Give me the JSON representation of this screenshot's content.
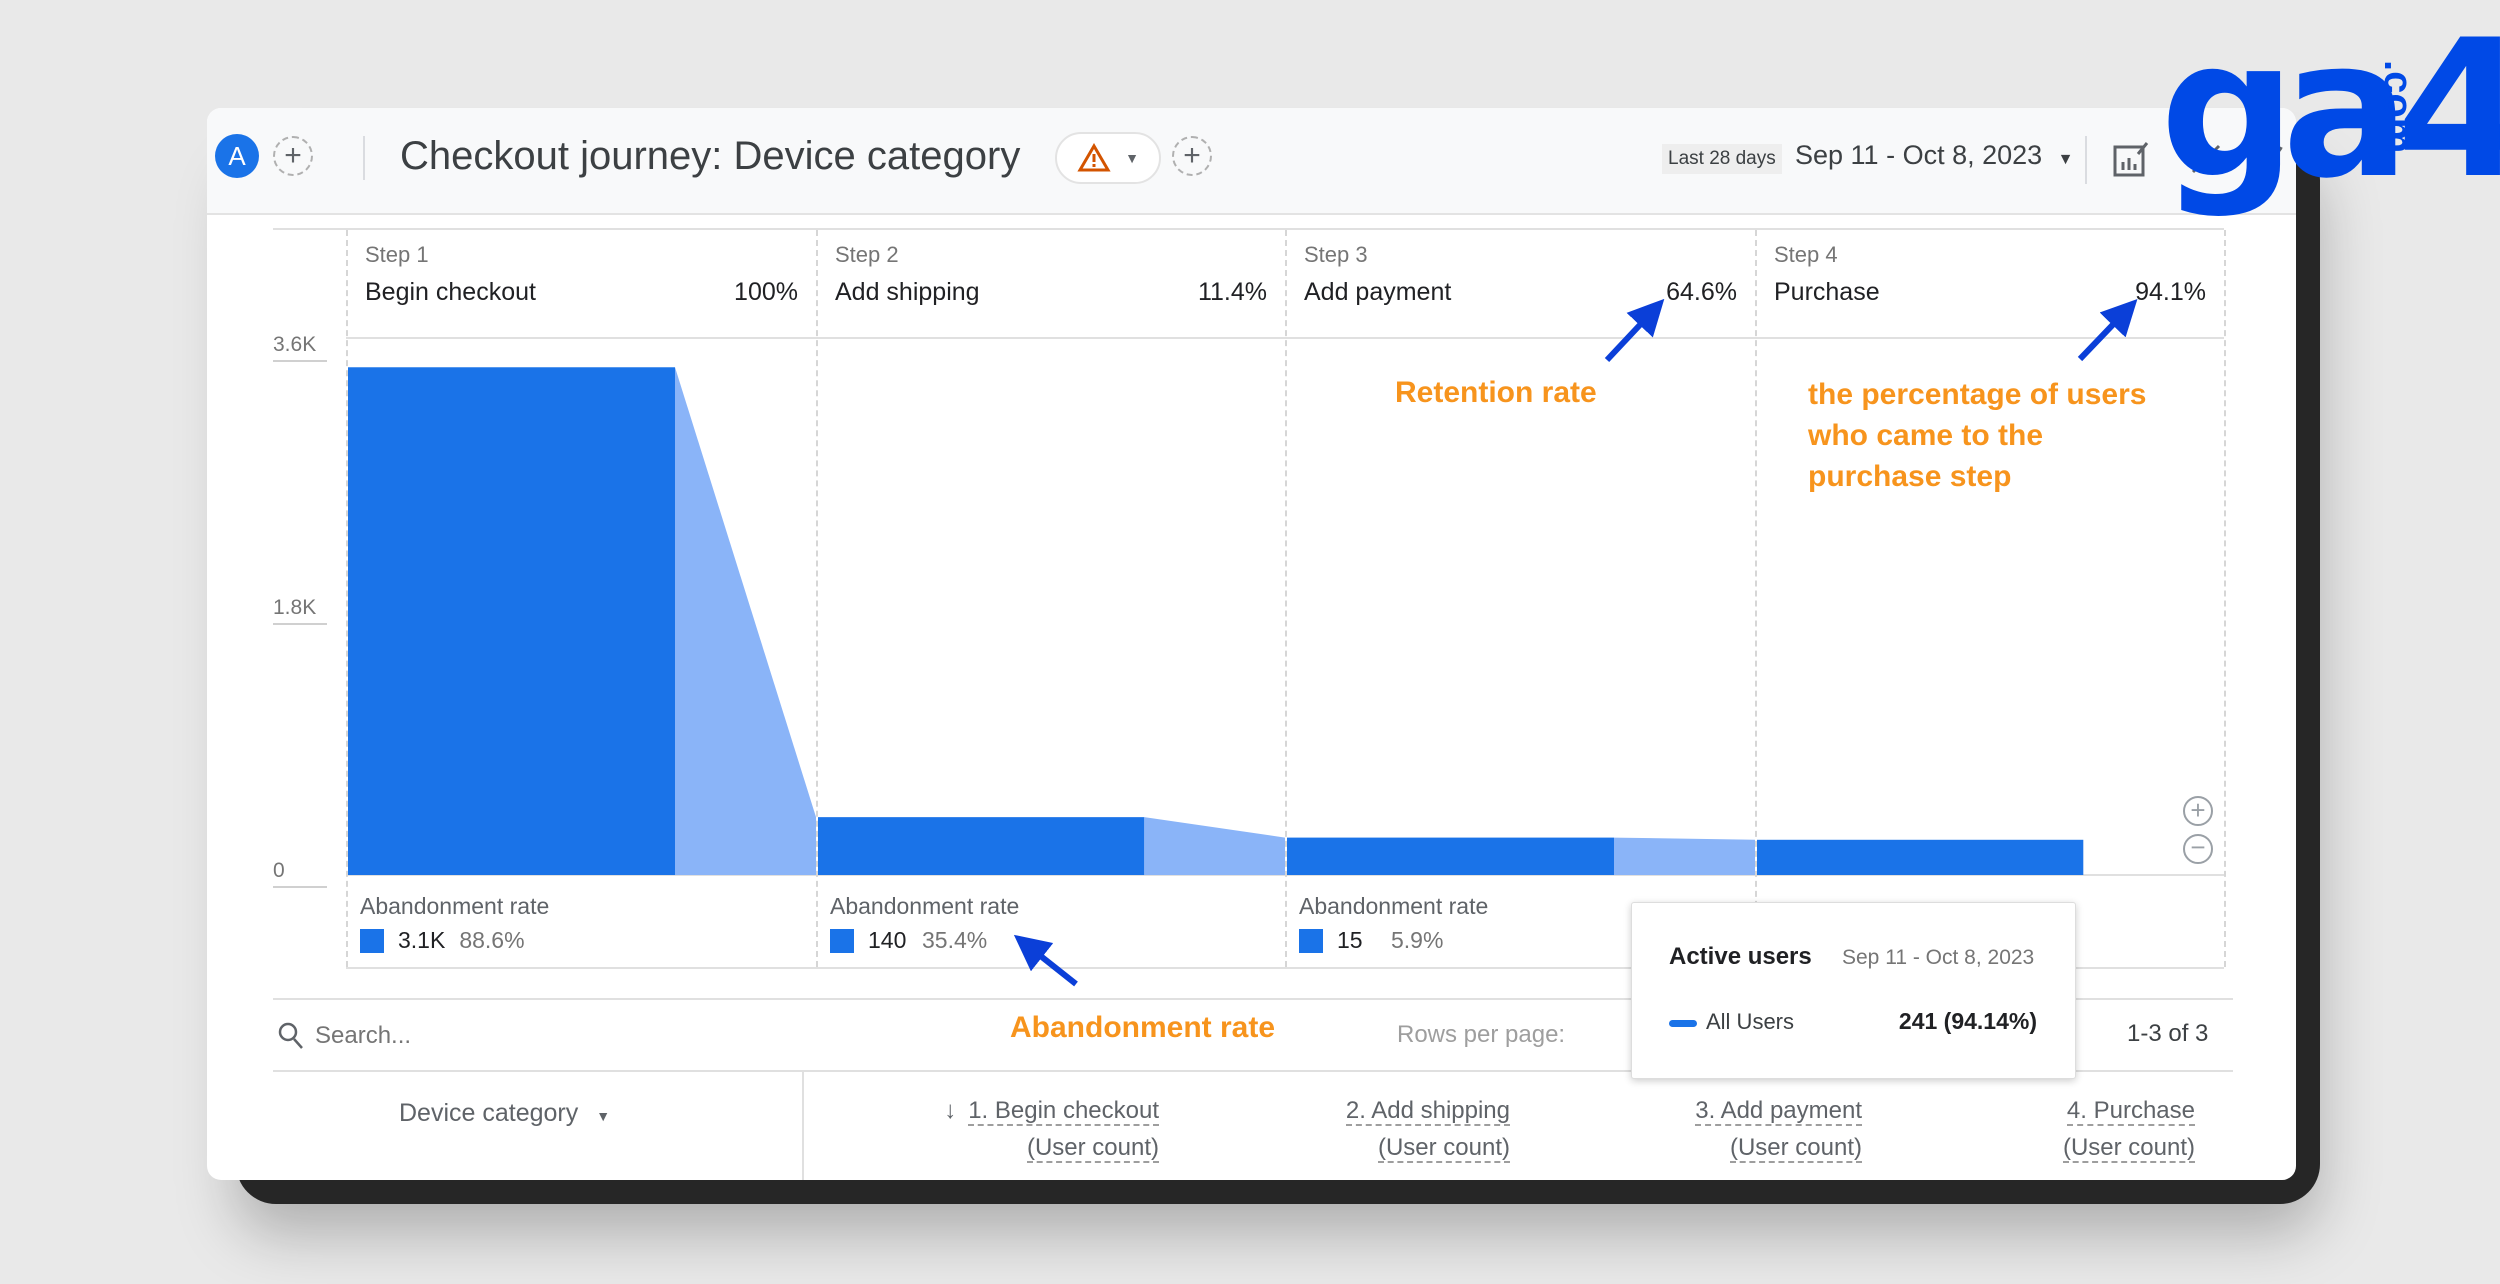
{
  "header": {
    "avatar_letter": "A",
    "title": "Checkout journey: Device category",
    "date_preset": "Last 28 days",
    "date_range": "Sep 11 - Oct 8, 2023"
  },
  "logo": {
    "text": "ga4",
    "suffix": ".com",
    "color": "#0049e6"
  },
  "funnel": {
    "steps": [
      {
        "step": "Step 1",
        "name": "Begin checkout",
        "rate": "100%",
        "abandon_label": "Abandonment rate",
        "abandon_count": "3.1K",
        "abandon_rate": "88.6%"
      },
      {
        "step": "Step 2",
        "name": "Add shipping",
        "rate": "11.4%",
        "abandon_label": "Abandonment rate",
        "abandon_count": "140",
        "abandon_rate": "35.4%"
      },
      {
        "step": "Step 3",
        "name": "Add payment",
        "rate": "64.6%",
        "abandon_label": "Abandonment rate",
        "abandon_count": "15",
        "abandon_rate": "5.9%"
      },
      {
        "step": "Step 4",
        "name": "Purchase",
        "rate": "94.1%"
      }
    ],
    "y_ticks": [
      "3.6K",
      "1.8K",
      "0"
    ]
  },
  "chart_data": {
    "type": "bar",
    "categories": [
      "Begin checkout",
      "Add shipping",
      "Add payment",
      "Purchase"
    ],
    "values": [
      3475,
      396,
      256,
      241
    ],
    "ylim": [
      0,
      3600
    ],
    "y_ticks": [
      0,
      1800,
      3600
    ],
    "colors": {
      "bar": "#1a73e8",
      "dropoff": "#8ab4f8"
    }
  },
  "annotations": {
    "retention": "Retention rate",
    "purchase_lines": [
      "the percentage of users",
      "who came to the",
      "purchase step"
    ],
    "abandonment": "Abandonment rate",
    "color": "#f7941d",
    "arrow_color": "#0b3fd8"
  },
  "tooltip": {
    "title": "Active users",
    "date": "Sep 11 - Oct 8, 2023",
    "series": "All Users",
    "value": "241 (94.14%)"
  },
  "table": {
    "search_placeholder": "Search...",
    "rows_per_page": "Rows per page:",
    "pagination": "1-3 of 3",
    "dimension": "Device category",
    "columns": [
      {
        "name": "1. Begin checkout",
        "sub": "(User count)"
      },
      {
        "name": "2. Add shipping",
        "sub": "(User count)"
      },
      {
        "name": "3. Add payment",
        "sub": "(User count)"
      },
      {
        "name": "4. Purchase",
        "sub": "(User count)"
      }
    ]
  }
}
